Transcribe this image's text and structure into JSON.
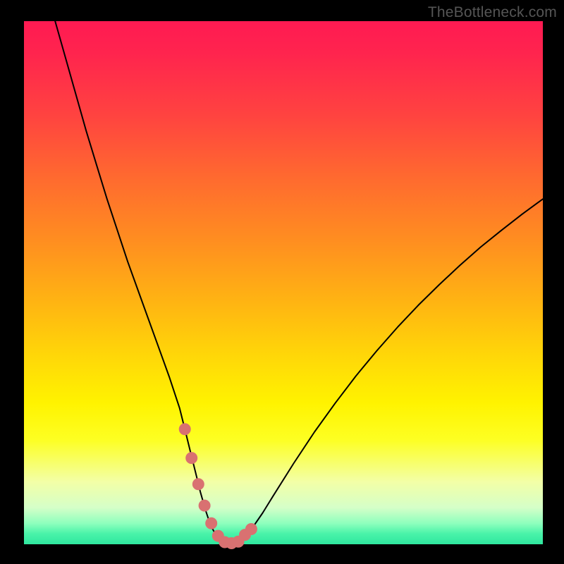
{
  "watermark": "TheBottleneck.com",
  "colors": {
    "curve_stroke": "#000000",
    "marker_fill": "#d97171",
    "marker_stroke": "#d97171"
  },
  "chart_data": {
    "type": "line",
    "title": "",
    "xlabel": "",
    "ylabel": "",
    "xlim": [
      0,
      100
    ],
    "ylim": [
      0,
      100
    ],
    "series": [
      {
        "name": "bottleneck-curve",
        "x": [
          6,
          8,
          10,
          12,
          14,
          16,
          18,
          20,
          22,
          24,
          26,
          28,
          30,
          31,
          32,
          33,
          34,
          35,
          36,
          37,
          38,
          39,
          40,
          42,
          44,
          46,
          48,
          52,
          56,
          60,
          64,
          68,
          72,
          76,
          80,
          84,
          88,
          92,
          96,
          100
        ],
        "y": [
          100,
          93,
          86,
          79,
          72.5,
          66,
          60,
          54,
          48.5,
          43,
          37.5,
          32,
          26,
          22,
          18,
          14,
          10,
          6.5,
          3.5,
          1.8,
          0.7,
          0.2,
          0.2,
          1.0,
          3.1,
          6.0,
          9.2,
          15.5,
          21.5,
          27.0,
          32.2,
          37.0,
          41.5,
          45.7,
          49.6,
          53.3,
          56.8,
          60.0,
          63.1,
          66.0
        ]
      }
    ],
    "markers": {
      "name": "highlight-points",
      "x": [
        31.0,
        32.3,
        33.6,
        34.8,
        36.1,
        37.4,
        38.7,
        40.0,
        41.3,
        42.6,
        43.8
      ],
      "y": [
        22.0,
        16.5,
        11.5,
        7.4,
        4.0,
        1.6,
        0.4,
        0.2,
        0.5,
        1.8,
        2.9
      ],
      "r": 8
    }
  }
}
